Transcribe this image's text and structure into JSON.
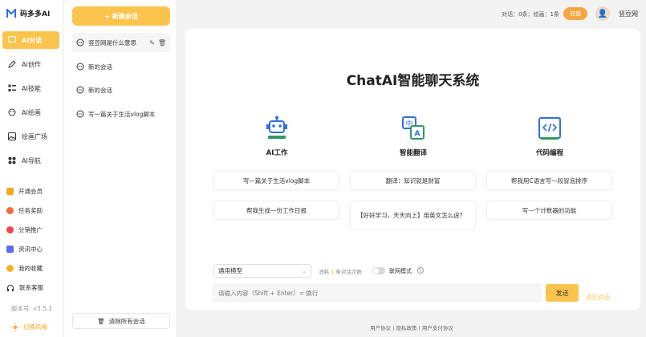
{
  "app": {
    "name": "码多多AI",
    "version": "版本号: v3.5.1"
  },
  "nav": {
    "items": [
      {
        "label": "AI对话",
        "icon": "chat-icon",
        "active": true
      },
      {
        "label": "AI创作",
        "icon": "pen-icon"
      },
      {
        "label": "AI技能",
        "icon": "skills-icon"
      },
      {
        "label": "AI绘画",
        "icon": "paint-icon"
      },
      {
        "label": "绘画广场",
        "icon": "gallery-icon"
      },
      {
        "label": "AI导航",
        "icon": "nav-grid-icon"
      }
    ],
    "sub": [
      {
        "label": "开通会员",
        "icon": "vip-icon",
        "color": "#f5a623"
      },
      {
        "label": "任务奖励",
        "icon": "reward-icon",
        "color": "#f26b3a"
      },
      {
        "label": "分销推广",
        "icon": "promo-icon",
        "color": "#e94a4a"
      },
      {
        "label": "资讯中心",
        "icon": "news-icon",
        "color": "#5b6cf0"
      },
      {
        "label": "我的收藏",
        "icon": "favorite-icon",
        "color": "#f5b324"
      },
      {
        "label": "联系客服",
        "icon": "headset-icon",
        "color": "#333333"
      }
    ],
    "switch_style": "切换风格"
  },
  "conversations": {
    "new_label": "+ 新建会话",
    "items": [
      {
        "label": "竖豆网是什么意思",
        "active": true
      },
      {
        "label": "新的会话"
      },
      {
        "label": "新的会话"
      },
      {
        "label": "写一篇关于生活vlog脚本"
      }
    ],
    "clear_label": "清除所有会话"
  },
  "topbar": {
    "usage": "对话：0条；绘画：1条",
    "recharge": "充值",
    "username": "竖豆网"
  },
  "main": {
    "title": "ChatAI智能聊天系统",
    "features": [
      {
        "label": "AI工作",
        "icon": "robot-icon"
      },
      {
        "label": "智能翻译",
        "icon": "translate-icon"
      },
      {
        "label": "代码编程",
        "icon": "code-icon"
      }
    ],
    "prompts": [
      "写一篇关于生活vlog脚本",
      "翻译：知识就是财富",
      "帮我用C语言写一段冒泡排序",
      "帮我生成一份工作日报",
      "【好好学习，天天向上】用英文怎么说？",
      "写一个计数器的功能"
    ],
    "model": "通用模型",
    "consume_prefix": "消耗",
    "consume_num": "1",
    "consume_suffix": "条对话次数",
    "network_mode": "联网模式",
    "input_placeholder": "请输入内容（Shift + Enter）= 换行",
    "send": "发送",
    "clear_conversation": "清空对话"
  },
  "footer": "用户协议 | 隐私政策 | 用户支付协议",
  "colors": {
    "accent": "#fbc44d",
    "icon_blue": "#2f6fe0",
    "icon_green": "#2f9a64"
  }
}
